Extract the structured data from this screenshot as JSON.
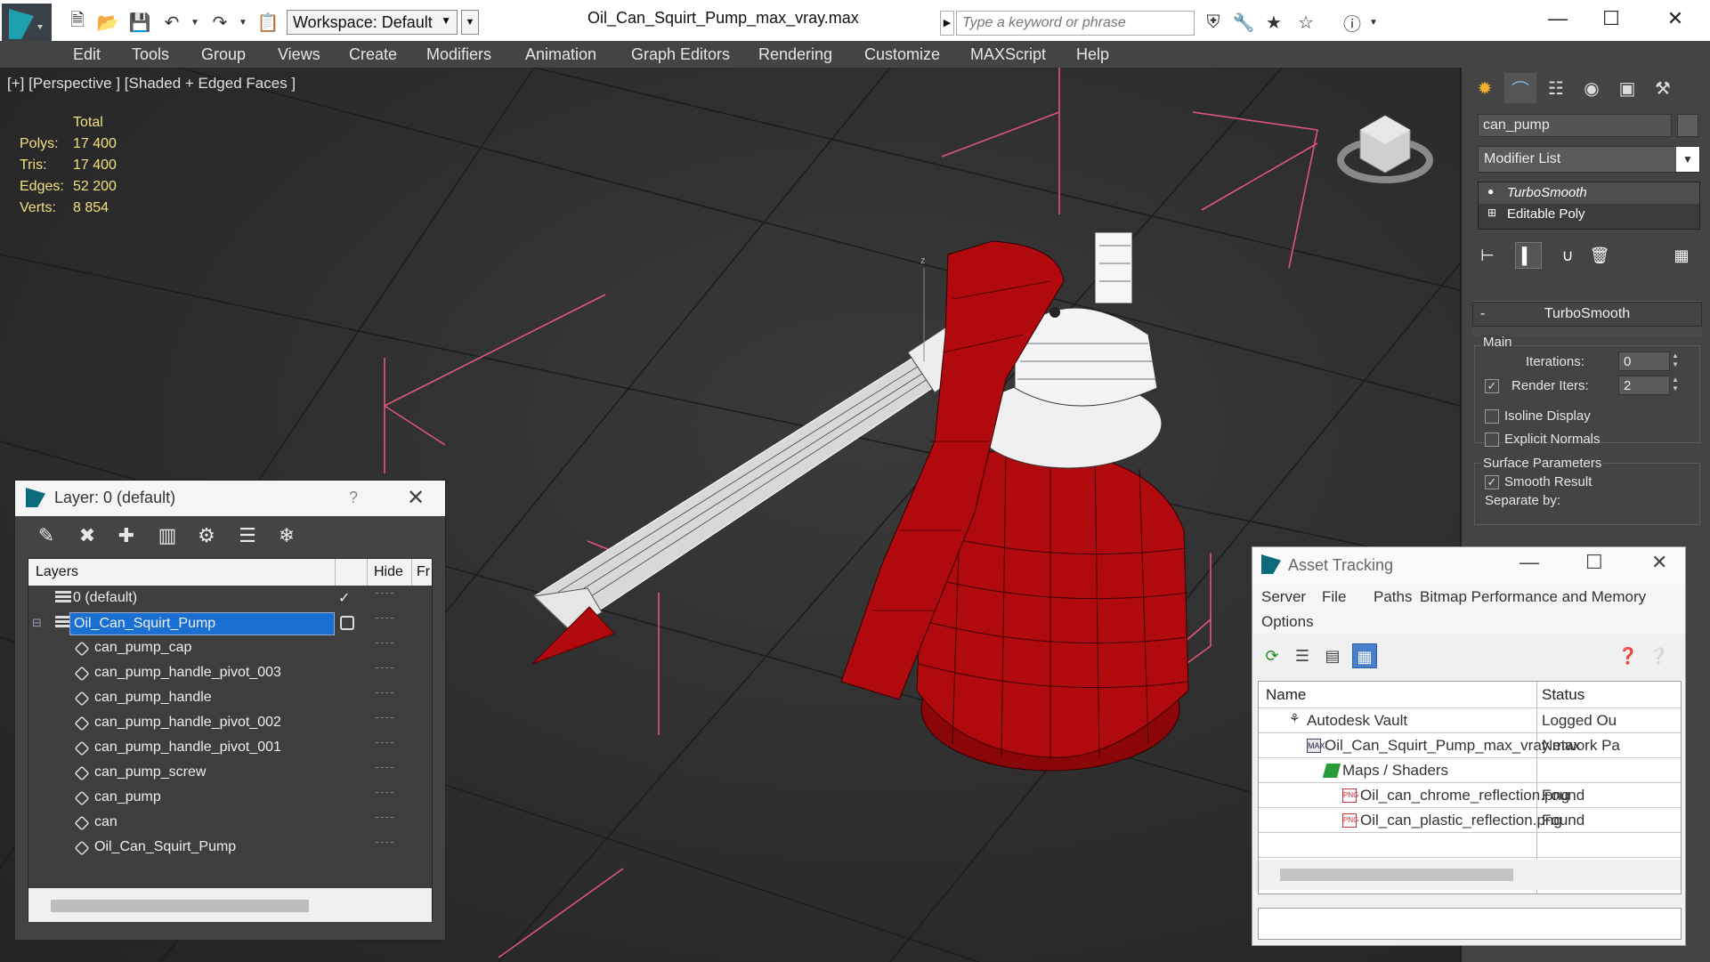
{
  "app": {
    "window_title": "Oil_Can_Squirt_Pump_max_vray.max",
    "workspace": "Workspace: Default",
    "search_placeholder": "Type a keyword or phrase"
  },
  "menu": [
    "Edit",
    "Tools",
    "Group",
    "Views",
    "Create",
    "Modifiers",
    "Animation",
    "Graph Editors",
    "Rendering",
    "Customize",
    "MAXScript",
    "Help"
  ],
  "viewport": {
    "label": "[+] [Perspective ] [Shaded + Edged Faces ]",
    "stats_header": "Total",
    "stats": [
      {
        "key": "Polys:",
        "value": "17 400"
      },
      {
        "key": "Tris:",
        "value": "17 400"
      },
      {
        "key": "Edges:",
        "value": "52 200"
      },
      {
        "key": "Verts:",
        "value": "8 854"
      }
    ]
  },
  "command_panel": {
    "object_name": "can_pump",
    "modifier_list": "Modifier List",
    "stack": [
      "TurboSmooth",
      "Editable Poly"
    ],
    "rollout_title": "TurboSmooth",
    "minus": "-",
    "main_group": "Main",
    "iterations_label": "Iterations:",
    "iterations_value": "0",
    "render_iters_label": "Render Iters:",
    "render_iters_value": "2",
    "isoline_label": "Isoline Display",
    "explicit_normals_label": "Explicit Normals",
    "surface_params_label": "Surface Parameters",
    "smooth_result_label": "Smooth Result",
    "separate_by_label": "Separate by:"
  },
  "layer_explorer": {
    "title": "Layer: 0 (default)",
    "help": "?",
    "columns": {
      "layers": "Layers",
      "hide": "Hide",
      "freeze": "Fr"
    },
    "rows": [
      {
        "name": "0 (default)",
        "type": "layer",
        "indent": 0
      },
      {
        "name": "Oil_Can_Squirt_Pump",
        "type": "layer",
        "indent": 0,
        "selected": true
      },
      {
        "name": "can_pump_cap",
        "type": "object",
        "indent": 1
      },
      {
        "name": "can_pump_handle_pivot_003",
        "type": "object",
        "indent": 1
      },
      {
        "name": "can_pump_handle",
        "type": "object",
        "indent": 1
      },
      {
        "name": "can_pump_handle_pivot_002",
        "type": "object",
        "indent": 1
      },
      {
        "name": "can_pump_handle_pivot_001",
        "type": "object",
        "indent": 1
      },
      {
        "name": "can_pump_screw",
        "type": "object",
        "indent": 1
      },
      {
        "name": "can_pump",
        "type": "object",
        "indent": 1
      },
      {
        "name": "can",
        "type": "object",
        "indent": 1
      },
      {
        "name": "Oil_Can_Squirt_Pump",
        "type": "object",
        "indent": 1
      }
    ]
  },
  "asset_tracking": {
    "title": "Asset Tracking",
    "menu": [
      "Server",
      "File",
      "Paths",
      "Bitmap Performance and Memory",
      "Options"
    ],
    "columns": {
      "name": "Name",
      "status": "Status"
    },
    "rows": [
      {
        "name": "Autodesk Vault",
        "status": "Logged Ou",
        "icon": "vault-icon"
      },
      {
        "name": "Oil_Can_Squirt_Pump_max_vray.max",
        "status": "Network Pa",
        "icon": "max-file-icon"
      },
      {
        "name": "Maps / Shaders",
        "status": "",
        "icon": "maps-icon"
      },
      {
        "name": "Oil_can_chrome_reflection.png",
        "status": "Found",
        "icon": "png-icon"
      },
      {
        "name": "Oil_can_plastic_reflection.png",
        "status": "Found",
        "icon": "png-icon"
      }
    ]
  },
  "colors": {
    "viewport_bg": "#2b2b2b",
    "model_red": "#b00a0f",
    "wireframe": "#ffffff",
    "bbox_pink": "#e0567a",
    "selection_blue": "#1a6fd3",
    "stats_yellow": "#f0e080"
  }
}
